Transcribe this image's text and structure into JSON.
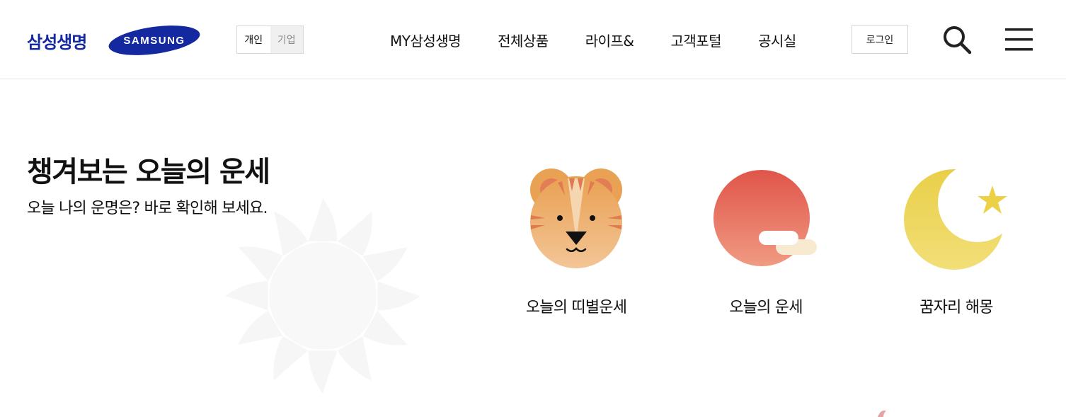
{
  "header": {
    "brand_name": "삼성생명",
    "samsung_logo_text": "SAMSUNG",
    "segment": {
      "personal": "개인",
      "corporate": "기업",
      "selected": "개인"
    },
    "nav": [
      {
        "label": "MY삼성생명"
      },
      {
        "label": "전체상품"
      },
      {
        "label": "라이프&"
      },
      {
        "label": "고객포털"
      },
      {
        "label": "공시실"
      }
    ],
    "login_label": "로그인",
    "search_icon": "search-icon",
    "menu_icon": "hamburger-menu-icon"
  },
  "main": {
    "title": "챙겨보는 오늘의 운세",
    "subtitle": "오늘 나의 운명은? 바로 확인해 보세요.",
    "cards": [
      {
        "label": "오늘의 띠별운세",
        "icon": "tiger-icon"
      },
      {
        "label": "오늘의 운세",
        "icon": "sunrise-icon"
      },
      {
        "label": "꿈자리 해몽",
        "icon": "moon-star-icon"
      }
    ]
  },
  "colors": {
    "brand_blue": "#1428a0",
    "tiger_orange": "#eba55d",
    "sun_red": "#e2574c",
    "moon_yellow": "#ecd45a"
  }
}
